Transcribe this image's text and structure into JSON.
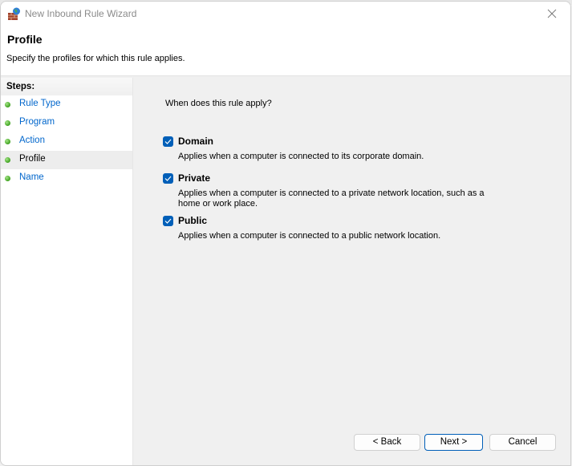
{
  "window": {
    "title": "New Inbound Rule Wizard",
    "icon": "firewall-icon",
    "close_icon": "close-icon"
  },
  "header": {
    "title": "Profile",
    "subtitle": "Specify the profiles for which this rule applies."
  },
  "steps": {
    "heading": "Steps:",
    "items": [
      {
        "label": "Rule Type",
        "active": false
      },
      {
        "label": "Program",
        "active": false
      },
      {
        "label": "Action",
        "active": false
      },
      {
        "label": "Profile",
        "active": true
      },
      {
        "label": "Name",
        "active": false
      }
    ]
  },
  "content": {
    "question": "When does this rule apply?",
    "options": [
      {
        "label": "Domain",
        "checked": true,
        "description": "Applies when a computer is connected to its corporate domain."
      },
      {
        "label": "Private",
        "checked": true,
        "description": "Applies when a computer is connected to a private network location, such as a home or work place."
      },
      {
        "label": "Public",
        "checked": true,
        "description": "Applies when a computer is connected to a public network location."
      }
    ]
  },
  "buttons": {
    "back": "< Back",
    "next": "Next >",
    "cancel": "Cancel"
  },
  "colors": {
    "accent": "#005fb8",
    "link": "#0066cc",
    "step_dot": "#3da11d"
  }
}
